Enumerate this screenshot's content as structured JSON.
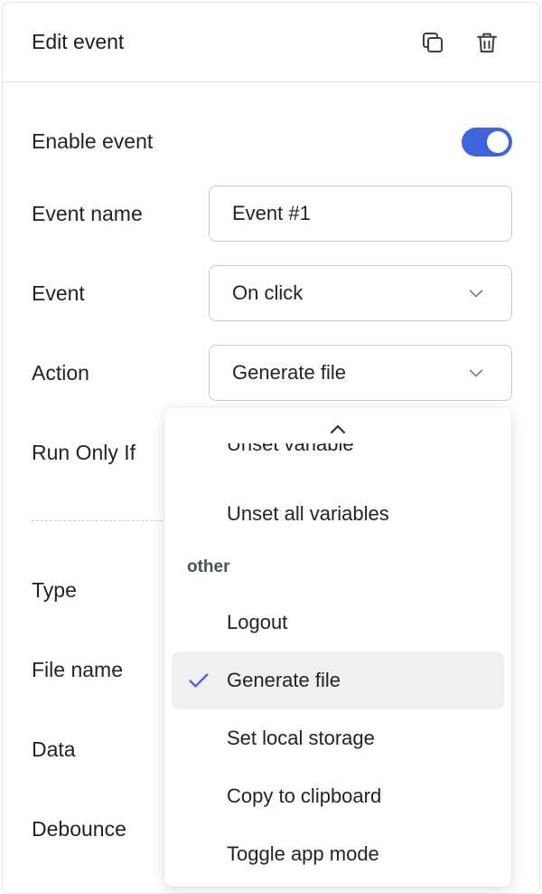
{
  "header": {
    "title": "Edit event",
    "duplicate_icon": "copy-icon",
    "delete_icon": "trash-icon"
  },
  "form": {
    "enable_label": "Enable event",
    "enabled": true,
    "event_name_label": "Event name",
    "event_name_value": "Event #1",
    "event_label": "Event",
    "event_value": "On click",
    "action_label": "Action",
    "action_value": "Generate file",
    "run_only_if_label": "Run Only If",
    "type_label": "Type",
    "file_name_label": "File name",
    "data_label": "Data",
    "debounce_label": "Debounce"
  },
  "action_menu": {
    "scroll_up_icon": "chevron-up-icon",
    "items_above": [
      "Unset variable",
      "Unset all variables"
    ],
    "group_label": "other",
    "group_items": [
      "Logout",
      "Generate file",
      "Set local storage",
      "Copy to clipboard",
      "Toggle app mode"
    ],
    "selected": "Generate file"
  },
  "colors": {
    "accent": "#3e63dd",
    "border": "#c8ccd1",
    "selected_bg": "#f0f0f1"
  }
}
